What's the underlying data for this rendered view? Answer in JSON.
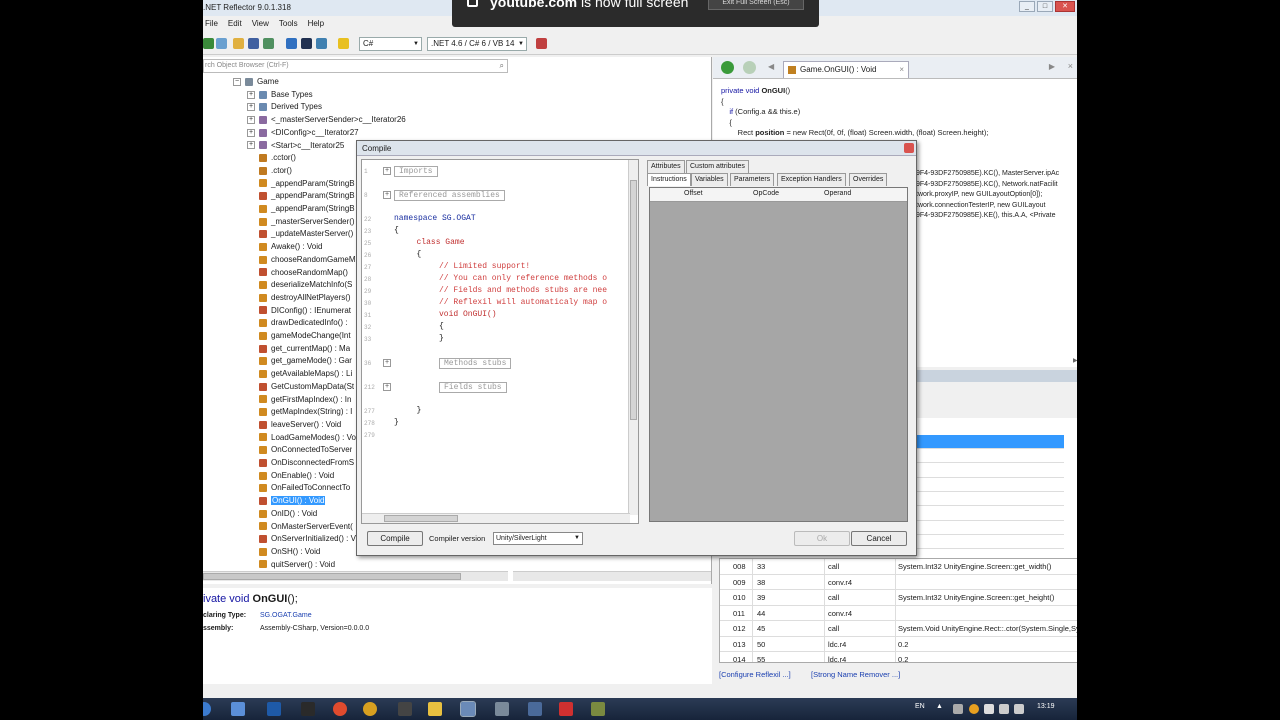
{
  "window": {
    "title": ".NET Reflector 9.0.1.318",
    "controls": [
      "_",
      "□",
      "✕"
    ]
  },
  "menu": [
    "File",
    "Edit",
    "View",
    "Tools",
    "Help"
  ],
  "toolbar": {
    "language": "C#",
    "framework": ".NET 4.6 / C# 6 / VB 14"
  },
  "youtube_overlay": {
    "domain": "youtube.com",
    "suffix": " is now full screen",
    "exit_label": "Exit Full Screen (Esc)"
  },
  "left": {
    "search_placeholder": "rch Object Browser (Ctrl-F)",
    "tree": [
      {
        "label": "Game",
        "indent": 0,
        "exp": "⊟"
      },
      {
        "label": "Base Types",
        "indent": 1,
        "exp": "⊞"
      },
      {
        "label": "Derived Types",
        "indent": 1,
        "exp": "⊞"
      },
      {
        "label": "<_masterServerSender>c__Iterator26",
        "indent": 1,
        "exp": "⊞"
      },
      {
        "label": "<DIConfig>c__Iterator27",
        "indent": 1,
        "exp": "⊞"
      },
      {
        "label": "<Start>c__Iterator25",
        "indent": 1,
        "exp": "⊞"
      },
      {
        "label": ".cctor()",
        "indent": 1,
        "exp": ""
      },
      {
        "label": ".ctor()",
        "indent": 1,
        "exp": ""
      },
      {
        "label": "_appendParam(StringB",
        "indent": 1,
        "exp": ""
      },
      {
        "label": "_appendParam(StringB",
        "indent": 1,
        "exp": ""
      },
      {
        "label": "_appendParam(StringB",
        "indent": 1,
        "exp": ""
      },
      {
        "label": "_masterServerSender()",
        "indent": 1,
        "exp": ""
      },
      {
        "label": "_updateMasterServer()",
        "indent": 1,
        "exp": ""
      },
      {
        "label": "Awake() : Void",
        "indent": 1,
        "exp": ""
      },
      {
        "label": "chooseRandomGameM",
        "indent": 1,
        "exp": ""
      },
      {
        "label": "chooseRandomMap()",
        "indent": 1,
        "exp": ""
      },
      {
        "label": "deserializeMatchInfo(S",
        "indent": 1,
        "exp": ""
      },
      {
        "label": "destroyAllNetPlayers()",
        "indent": 1,
        "exp": ""
      },
      {
        "label": "DIConfig() : IEnumerat",
        "indent": 1,
        "exp": ""
      },
      {
        "label": "drawDedicatedInfo() :",
        "indent": 1,
        "exp": ""
      },
      {
        "label": "gameModeChange(Int",
        "indent": 1,
        "exp": ""
      },
      {
        "label": "get_currentMap() : Ma",
        "indent": 1,
        "exp": ""
      },
      {
        "label": "get_gameMode() : Gar",
        "indent": 1,
        "exp": ""
      },
      {
        "label": "getAvailableMaps() : Li",
        "indent": 1,
        "exp": ""
      },
      {
        "label": "GetCustomMapData(St",
        "indent": 1,
        "exp": ""
      },
      {
        "label": "getFirstMapIndex() : In",
        "indent": 1,
        "exp": ""
      },
      {
        "label": "getMapIndex(String) : I",
        "indent": 1,
        "exp": ""
      },
      {
        "label": "leaveServer() : Void",
        "indent": 1,
        "exp": ""
      },
      {
        "label": "LoadGameModes() : Vo",
        "indent": 1,
        "exp": ""
      },
      {
        "label": "OnConnectedToServer",
        "indent": 1,
        "exp": ""
      },
      {
        "label": "OnDisconnectedFromS",
        "indent": 1,
        "exp": ""
      },
      {
        "label": "OnEnable() : Void",
        "indent": 1,
        "exp": ""
      },
      {
        "label": "OnFailedToConnectTo",
        "indent": 1,
        "exp": ""
      },
      {
        "label": "OnGUI() : Void",
        "indent": 1,
        "exp": "",
        "selected": true
      },
      {
        "label": "OnID() : Void",
        "indent": 1,
        "exp": ""
      },
      {
        "label": "OnMasterServerEvent(",
        "indent": 1,
        "exp": ""
      },
      {
        "label": "OnServerInitialized() : V",
        "indent": 1,
        "exp": ""
      },
      {
        "label": "OnSH() : Void",
        "indent": 1,
        "exp": ""
      },
      {
        "label": "quitServer() : Void",
        "indent": 1,
        "exp": ""
      }
    ]
  },
  "info": {
    "sig_prefix": "ivate void ",
    "sig_name": "OnGUI",
    "sig_suffix": "();",
    "declaring_type_label": "claring Type:",
    "declaring_type_value": "SG.OGAT.Game",
    "assembly_label": "ssembly:",
    "assembly_value": "Assembly-CSharp, Version=0.0.0.0"
  },
  "code_panel": {
    "tab_label": "Game.OnGUI() : Void",
    "lines": [
      {
        "kw": "private void ",
        "rest": "",
        "bold": "OnGUI",
        "tail": "()"
      },
      {
        "kw": "",
        "rest": "{",
        "bold": "",
        "tail": ""
      },
      {
        "kw": "    if ",
        "rest": "(Config.a && ",
        "bold": "",
        "tail": "this.e)"
      },
      {
        "kw": "",
        "rest": "    {",
        "bold": "",
        "tail": ""
      },
      {
        "kw": "",
        "rest": "        Rect ",
        "bold": "position",
        "tail": " = new Rect(0f, 0f, (float) Screen.width, (float) Screen.height);"
      }
    ],
    "snippets": [
      "9F4-93DF2750985E).KC(), MasterServer.ipAc",
      "9F4-93DF2750985E).KC(), Network.natFacilit",
      "twork.proxyIP, new GUILayoutOption[0]);",
      "twork.connectionTesterIP, new GUILayout",
      "9F4-93DF2750985E).KE(), this.A.A, <Private"
    ]
  },
  "compile_dialog": {
    "title": "Compile",
    "editor_lines": [
      {
        "ln": "1",
        "text": "Imports",
        "cls": "fold",
        "indent": 0,
        "fold": "⊞"
      },
      {
        "ln": "8",
        "text": "Referenced assemblies",
        "cls": "fold",
        "indent": 0,
        "fold": "⊞"
      },
      {
        "ln": "22",
        "text": "namespace SG.OGAT",
        "cls": "kwb",
        "indent": 0,
        "fold": ""
      },
      {
        "ln": "23",
        "text": "{",
        "cls": "",
        "indent": 0,
        "fold": ""
      },
      {
        "ln": "25",
        "text": "class Game",
        "cls": "kwr",
        "indent": 3,
        "fold": ""
      },
      {
        "ln": "26",
        "text": "{",
        "cls": "",
        "indent": 3,
        "fold": ""
      },
      {
        "ln": "27",
        "text": "// Limited support!",
        "cls": "cm",
        "indent": 6,
        "fold": ""
      },
      {
        "ln": "28",
        "text": "// You can only reference methods o",
        "cls": "cm",
        "indent": 6,
        "fold": ""
      },
      {
        "ln": "29",
        "text": "// Fields and methods stubs are nee",
        "cls": "cm",
        "indent": 6,
        "fold": ""
      },
      {
        "ln": "30",
        "text": "// Reflexil will automaticaly map o",
        "cls": "cm",
        "indent": 6,
        "fold": ""
      },
      {
        "ln": "31",
        "text": "void OnGUI()",
        "cls": "kwr",
        "indent": 6,
        "fold": ""
      },
      {
        "ln": "32",
        "text": "{",
        "cls": "",
        "indent": 6,
        "fold": ""
      },
      {
        "ln": "33",
        "text": "}",
        "cls": "",
        "indent": 6,
        "fold": ""
      },
      {
        "ln": "36",
        "text": "Methods stubs",
        "cls": "fold",
        "indent": 6,
        "fold": "⊞"
      },
      {
        "ln": "212",
        "text": "Fields stubs",
        "cls": "fold",
        "indent": 6,
        "fold": "⊞"
      },
      {
        "ln": "277",
        "text": "}",
        "cls": "",
        "indent": 3,
        "fold": ""
      },
      {
        "ln": "278",
        "text": "}",
        "cls": "",
        "indent": 0,
        "fold": ""
      },
      {
        "ln": "279",
        "text": "",
        "cls": "",
        "indent": 0,
        "fold": ""
      }
    ],
    "tabs_row1": [
      "Attributes",
      "Custom attributes"
    ],
    "tabs_row2": [
      "Instructions",
      "Variables",
      "Parameters",
      "Exception Handlers",
      "Overrides"
    ],
    "grid_headers": [
      "Offset",
      "OpCode",
      "Operand"
    ],
    "compile_button": "Compile",
    "compiler_version_label": "Compiler version",
    "compiler_version_value": "Unity/SilverLight",
    "ok_button": "Ok",
    "cancel_button": "Cancel"
  },
  "instructions": {
    "rows": [
      {
        "idx": "008",
        "off": "33",
        "op": "call",
        "operand": "System.Int32 UnityEngine.Screen::get_width()"
      },
      {
        "idx": "009",
        "off": "38",
        "op": "conv.r4",
        "operand": ""
      },
      {
        "idx": "010",
        "off": "39",
        "op": "call",
        "operand": "System.Int32 UnityEngine.Screen::get_height()"
      },
      {
        "idx": "011",
        "off": "44",
        "op": "conv.r4",
        "operand": ""
      },
      {
        "idx": "012",
        "off": "45",
        "op": "call",
        "operand": "System.Void UnityEngine.Rect::.ctor(System.Single,System.Single,System.Single,System.Single)"
      },
      {
        "idx": "013",
        "off": "50",
        "op": "ldc.r4",
        "operand": "0.2"
      },
      {
        "idx": "014",
        "off": "55",
        "op": "ldc.r4",
        "operand": "0.2"
      }
    ]
  },
  "links": {
    "configure": "[Configure Reflexil ...]",
    "strong_name": "[Strong Name Remover ...]"
  },
  "taskbar": {
    "lang": "EN",
    "time": "13:19"
  }
}
